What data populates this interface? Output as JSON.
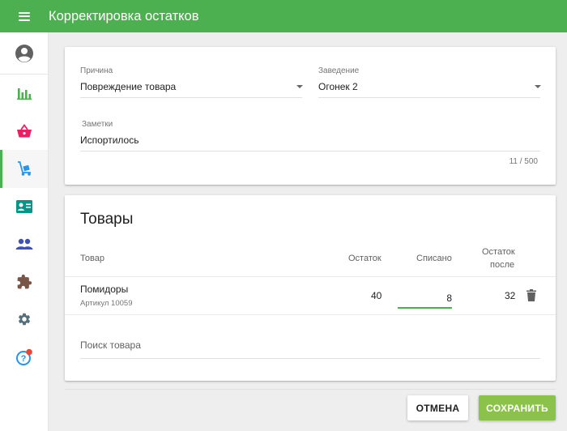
{
  "header": {
    "title": "Корректировка остатков",
    "color": "#4caf50",
    "menu_icon": "hamburger-icon"
  },
  "sidebar": {
    "avatar_icon": "account-circle-icon",
    "items": [
      {
        "icon": "bar-chart-icon",
        "color": "#4caf50"
      },
      {
        "icon": "shopping-basket-icon",
        "color": "#e91e63"
      },
      {
        "icon": "hand-truck-icon",
        "color": "#2196f3",
        "active": true
      },
      {
        "icon": "contact-card-icon",
        "color": "#009688"
      },
      {
        "icon": "people-icon",
        "color": "#3f51b5"
      },
      {
        "icon": "puzzle-icon",
        "color": "#795548"
      },
      {
        "icon": "gear-icon",
        "color": "#607d8b"
      },
      {
        "icon": "help-icon",
        "color": "#2196f3",
        "badge_color": "#f44336"
      }
    ]
  },
  "form": {
    "reason": {
      "label": "Причина",
      "value": "Повреждение товара"
    },
    "venue": {
      "label": "Заведение",
      "value": "Огонек 2"
    },
    "notes": {
      "label": "Заметки",
      "value": "Испортилось",
      "counter": "11 / 500"
    }
  },
  "products": {
    "title": "Товары",
    "columns": {
      "product": "Товар",
      "stock": "Остаток",
      "written_off": "Списано",
      "after_line1": "Остаток",
      "after_line2": "после"
    },
    "rows": [
      {
        "name": "Помидоры",
        "sku": "Артикул 10059",
        "stock": "40",
        "written_off": "8",
        "after": "32"
      }
    ],
    "search_placeholder": "Поиск товара"
  },
  "actions": {
    "cancel": "ОТМЕНА",
    "save": "СОХРАНИТЬ"
  }
}
